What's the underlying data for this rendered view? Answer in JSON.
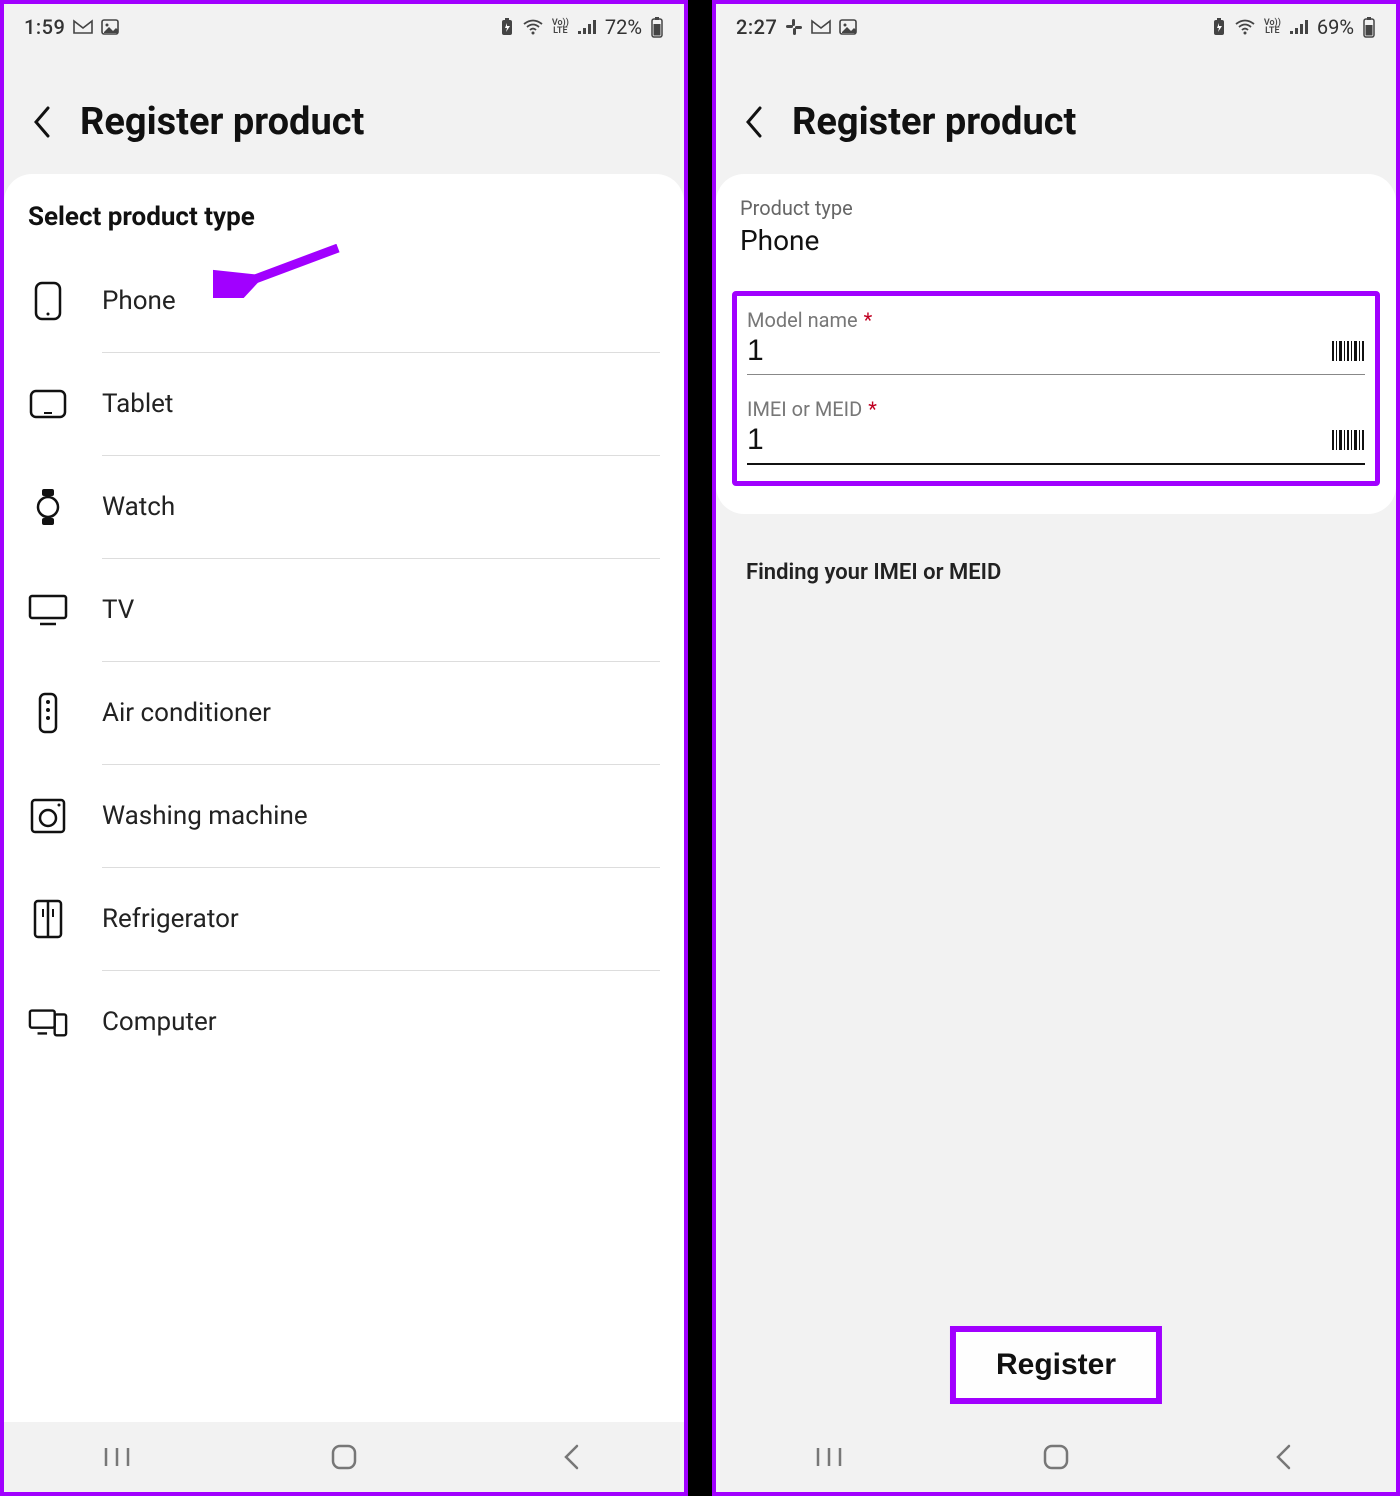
{
  "left": {
    "status": {
      "time": "1:59",
      "battery": "72%"
    },
    "title": "Register product",
    "section_title": "Select product type",
    "products": [
      {
        "id": "phone",
        "label": "Phone"
      },
      {
        "id": "tablet",
        "label": "Tablet"
      },
      {
        "id": "watch",
        "label": "Watch"
      },
      {
        "id": "tv",
        "label": "TV"
      },
      {
        "id": "ac",
        "label": "Air conditioner"
      },
      {
        "id": "washer",
        "label": "Washing machine"
      },
      {
        "id": "fridge",
        "label": "Refrigerator"
      },
      {
        "id": "computer",
        "label": "Computer"
      }
    ]
  },
  "right": {
    "status": {
      "time": "2:27",
      "battery": "69%"
    },
    "title": "Register product",
    "type_label": "Product type",
    "type_value": "Phone",
    "fields": {
      "model": {
        "label": "Model name",
        "required": "*",
        "value": "1"
      },
      "imei": {
        "label": "IMEI or MEID",
        "required": "*",
        "value": "1"
      }
    },
    "help": "Finding your IMEI or MEID",
    "register": "Register"
  }
}
